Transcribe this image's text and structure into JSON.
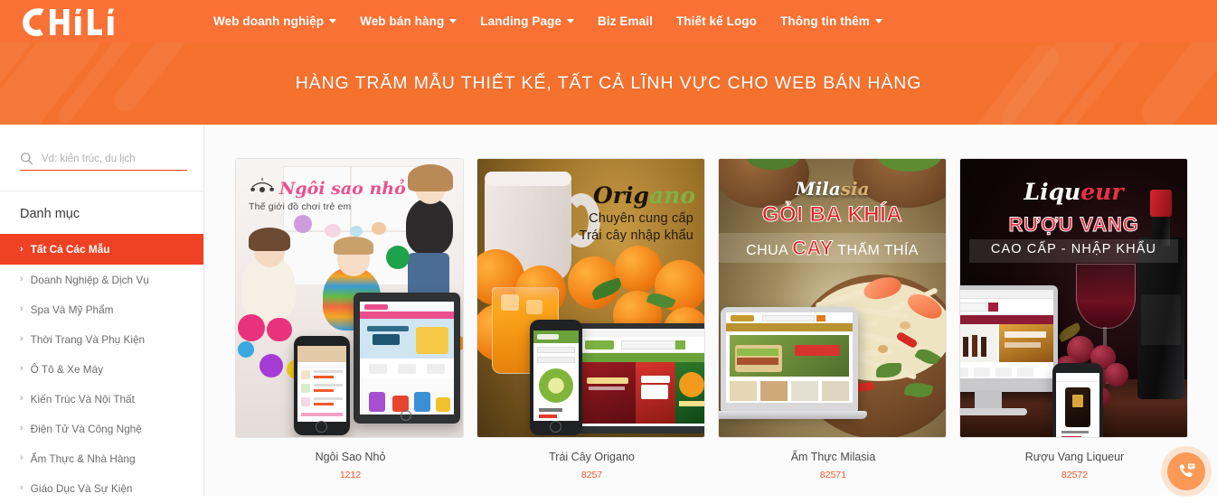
{
  "header": {
    "logo_text": "CHILI",
    "logo_icon": "chili-pepper-icon",
    "nav": [
      {
        "label": "Web doanh nghiệp",
        "has_dropdown": true
      },
      {
        "label": "Web bán hàng",
        "has_dropdown": true
      },
      {
        "label": "Landing Page",
        "has_dropdown": true
      },
      {
        "label": "Biz Email",
        "has_dropdown": false
      },
      {
        "label": "Thiết kế Logo",
        "has_dropdown": false
      },
      {
        "label": "Thông tin thêm",
        "has_dropdown": true
      }
    ]
  },
  "hero": {
    "title": "HÀNG TRĂM MẪU THIẾT KẾ, TẤT CẢ LĨNH VỰC CHO WEB BÁN HÀNG"
  },
  "sidebar": {
    "search": {
      "value": "",
      "placeholder": "Vd: kiến trúc, du lịch",
      "icon": "search-icon"
    },
    "category_heading": "Danh mục",
    "items": [
      {
        "label": "Tất Cả Các Mẫu",
        "active": true
      },
      {
        "label": "Doanh Nghiệp & Dịch Vụ",
        "active": false
      },
      {
        "label": "Spa Và Mỹ Phẩm",
        "active": false
      },
      {
        "label": "Thời Trang Và Phụ Kiện",
        "active": false
      },
      {
        "label": "Ô Tô & Xe Máy",
        "active": false
      },
      {
        "label": "Kiến Trúc Và Nội Thất",
        "active": false
      },
      {
        "label": "Điện Tử Và Công Nghệ",
        "active": false
      },
      {
        "label": "Ẩm Thực & Nhà Hàng",
        "active": false
      },
      {
        "label": "Giáo Dục Và Sự Kiện",
        "active": false
      }
    ]
  },
  "templates": [
    {
      "title": "Ngôi Sao Nhỏ",
      "code": "1212",
      "thumb": {
        "brand": "Ngôi sao nhỏ",
        "tagline": "Thế giới đồ chơi trẻ em",
        "theme": "children-toys"
      }
    },
    {
      "title": "Trái Cây Origano",
      "code": "8257",
      "thumb": {
        "brand_part1": "Orig",
        "brand_part2": "ano",
        "line1": "Chuyên cung cấp",
        "line2": "Trái cây nhập khẩu",
        "theme": "imported-fruit"
      }
    },
    {
      "title": "Ẩm Thực Milasia",
      "code": "82571",
      "thumb": {
        "brand_part1": "Mila",
        "brand_part2": "sia",
        "headline": "GỎI BA KHÍA",
        "sub_pre": "CHUA",
        "sub_big": "CAY",
        "sub_post": "THẤM THÍA",
        "theme": "restaurant-salad"
      }
    },
    {
      "title": "Rượu Vang Liqueur",
      "code": "82572",
      "thumb": {
        "brand_part1": "Liqu",
        "brand_part2": "eur",
        "headline": "RƯỢU VANG",
        "subhead": "CAO CẤP - NHẬP KHẨU",
        "theme": "wine-liqueur"
      }
    }
  ],
  "floating_action": {
    "icon": "phone-chat-icon",
    "label": ""
  },
  "colors": {
    "brand_orange": "#f97134",
    "hero_orange": "#f4712e",
    "active_red": "#ef4123",
    "code_orange": "#f0562a",
    "fab_orange": "#fb9a56"
  }
}
